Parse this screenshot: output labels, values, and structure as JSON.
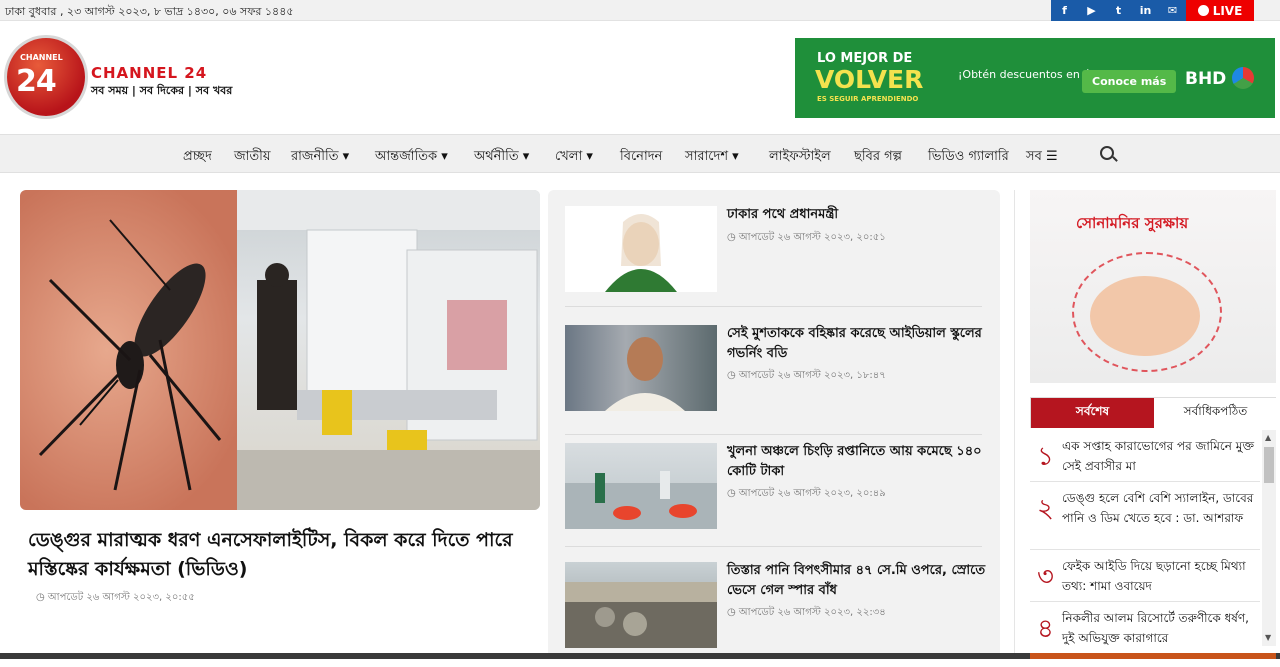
{
  "topbar": {
    "date": "ঢাকা  বুধবার , ২৩ আগস্ট ২০২৩, ৮ ভাদ্র ১৪৩০, ০৬ সফর ১৪৪৫",
    "social": [
      "f",
      "▶",
      "t",
      "in",
      "✉"
    ],
    "live_label": "LIVE"
  },
  "logo": {
    "badge_small": "CHANNEL",
    "badge_num": "24",
    "name": "CHANNEL 24",
    "tagline": "সব সময় | সব দিকের | সব খবর"
  },
  "ad": {
    "line1": "LO MEJOR DE",
    "line2": "VOLVER",
    "line3": "ES SEGUIR APRENDIENDO",
    "offer": "¡Obtén descuentos en útiles escolares!",
    "button": "Conoce más",
    "brand": "BHD"
  },
  "nav": {
    "items": [
      "প্রচ্ছদ",
      "জাতীয়",
      "রাজনীতি ▾",
      "আন্তর্জাতিক ▾",
      "অর্থনীতি ▾",
      "খেলা ▾",
      "বিনোদন",
      "সারাদেশ ▾",
      "লাইফস্টাইল",
      "ছবির গল্প",
      "ভিডিও গ্যালারি",
      "সব ☰"
    ]
  },
  "hero": {
    "title": "ডেঙ্গুর মারাত্মক ধরণ এনসেফালাইটিস, বিকল করে দিতে পারে মস্তিষ্কের কার্যক্ষমতা (ভিডিও)",
    "time": "আপডেট ২৬ আগস্ট ২০২৩, ২০:৫৫"
  },
  "stories": [
    {
      "title": "ঢাকার পথে প্রধানমন্ত্রী",
      "time": "আপডেট ২৬ আগস্ট ২০২৩, ২০:৫১"
    },
    {
      "title": "সেই মুশতাককে বহিষ্কার করেছে আইডিয়াল স্কুলের গভর্নিং বডি",
      "time": "আপডেট ২৬ আগস্ট ২০২৩, ১৮:৪৭"
    },
    {
      "title": "খুলনা অঞ্চলে চিংড়ি রপ্তানিতে আয় কমেছে ১৪০ কোটি টাকা",
      "time": "আপডেট ২৬ আগস্ট ২০২৩, ২০:৪৯"
    },
    {
      "title": "তিস্তার পানি বিপৎসীমার ৪৭ সে.মি ওপরে, স্রোতে ভেসে গেল স্পার বাঁধ",
      "time": "আপডেট ২৬ আগস্ট ২০২৩, ২২:৩৪"
    }
  ],
  "sidebar": {
    "ad_title": "সোনামনির সুরক্ষায়",
    "tab_latest": "সর্বশেষ",
    "tab_popular": "সর্বাধিকপঠিত",
    "latest": [
      {
        "num": "১",
        "text": "এক সপ্তাহ কারাভোগের পর জামিনে মুক্ত সেই প্রবাসীর মা"
      },
      {
        "num": "২",
        "text": "ডেঙ্গু হলে বেশি বেশি স্যালাইন, ডাবের পানি ও ডিম খেতে হবে : ডা. আশরাফ"
      },
      {
        "num": "৩",
        "text": "ফেইক আইডি দিয়ে ছড়ানো হচ্ছে মিথ্যা তথ্য: শামা ওবায়েদ"
      },
      {
        "num": "৪",
        "text": "নিকলীর আলম রিসোর্টে তরুণীকে ধর্ষণ, দুই অভিযুক্ত কারাগারে"
      }
    ]
  }
}
